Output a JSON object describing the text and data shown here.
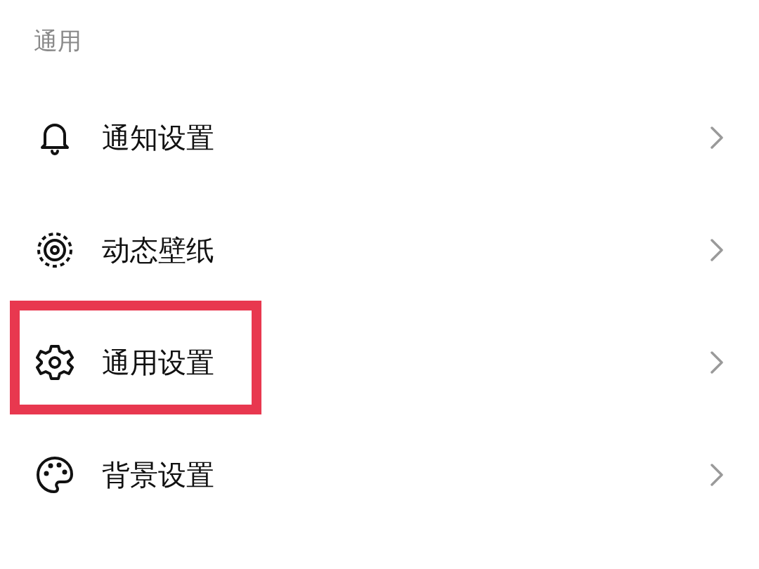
{
  "section": {
    "title": "通用"
  },
  "items": [
    {
      "kind": "bell",
      "label": "通知设置",
      "highlighted": false
    },
    {
      "kind": "wallpaper",
      "label": "动态壁纸",
      "highlighted": false
    },
    {
      "kind": "gear",
      "label": "通用设置",
      "highlighted": true
    },
    {
      "kind": "palette",
      "label": "背景设置",
      "highlighted": false
    }
  ]
}
